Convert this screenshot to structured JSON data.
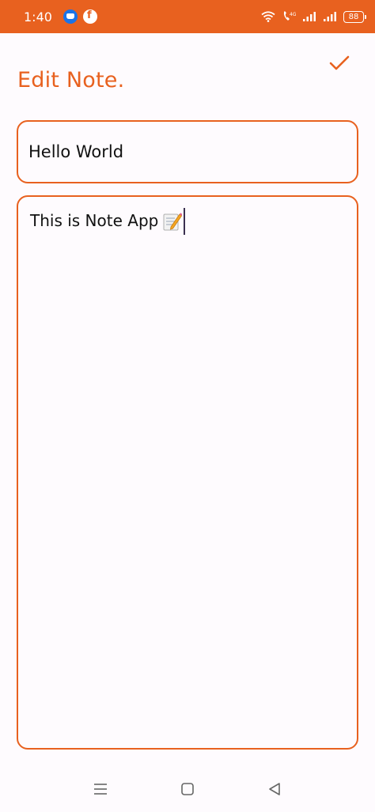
{
  "status_bar": {
    "time": "1:40",
    "battery_level": "88",
    "icons": [
      "drive-icon",
      "f-app-icon",
      "wifi-icon",
      "volte-icon",
      "signal-icon",
      "signal-icon-2",
      "battery-icon"
    ]
  },
  "header": {
    "title": "Edit Note.",
    "save_icon": "checkmark-icon"
  },
  "editor": {
    "title_value": "Hello World",
    "body_value": "This is Note App"
  },
  "nav": {
    "icons": [
      "menu-icon",
      "home-icon",
      "back-icon"
    ]
  },
  "colors": {
    "accent": "#e8611f",
    "background": "#fefbfe",
    "text": "#111111"
  }
}
